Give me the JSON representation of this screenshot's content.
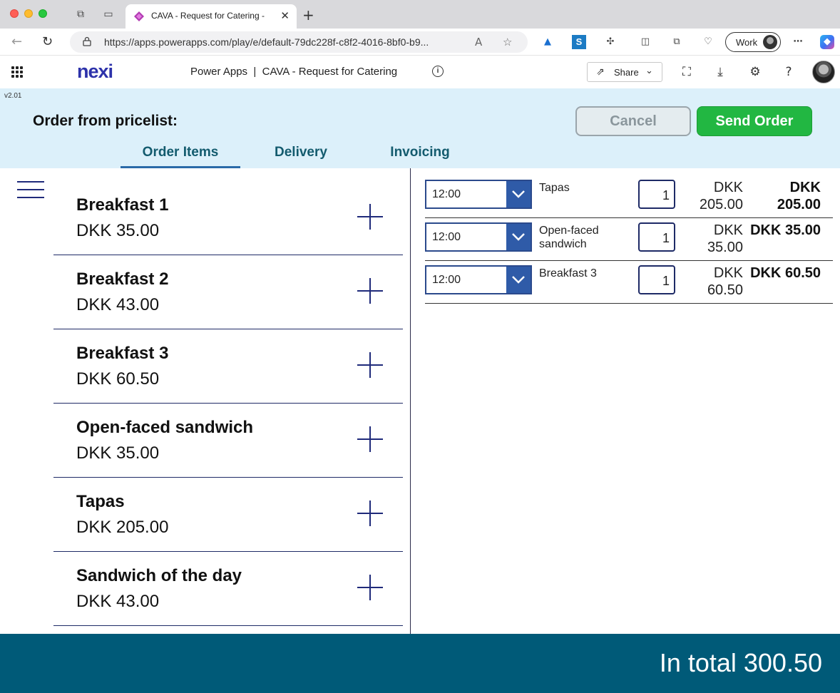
{
  "browser": {
    "tab_title": "CAVA - Request for Catering - ",
    "url": "https://apps.powerapps.com/play/e/default-79dc228f-c8f2-4016-8bf0-b9...",
    "profile_label": "Work"
  },
  "header": {
    "logo": "nexi",
    "app_title": "Power Apps  |  CAVA - Request for Catering",
    "share_label": "Share"
  },
  "app": {
    "version": "v2.01",
    "order_title": "Order from pricelist:",
    "cancel_label": "Cancel",
    "send_label": "Send Order",
    "tabs": [
      {
        "label": "Order Items",
        "active": true
      },
      {
        "label": "Delivery",
        "active": false
      },
      {
        "label": "Invoicing",
        "active": false
      }
    ],
    "menu_items": [
      {
        "name": "Breakfast 1",
        "price": "DKK 35.00"
      },
      {
        "name": "Breakfast 2",
        "price": "DKK 43.00"
      },
      {
        "name": "Breakfast 3",
        "price": "DKK 60.50"
      },
      {
        "name": "Open-faced sandwich",
        "price": "DKK 35.00"
      },
      {
        "name": "Tapas",
        "price": "DKK 205.00"
      },
      {
        "name": "Sandwich of the day",
        "price": "DKK 43.00"
      }
    ],
    "order_lines": [
      {
        "time": "12:00",
        "name": "Tapas",
        "qty": "1",
        "unit_price": "DKK 205.00",
        "total": "DKK 205.00"
      },
      {
        "time": "12:00",
        "name": "Open-faced sandwich",
        "qty": "1",
        "unit_price": "DKK 35.00",
        "total": "DKK 35.00"
      },
      {
        "time": "12:00",
        "name": "Breakfast 3",
        "qty": "1",
        "unit_price": "DKK 60.50",
        "total": "DKK 60.50"
      }
    ],
    "total_text": "In total 300.50"
  },
  "colors": {
    "brand": "#2d32aa",
    "band": "#dcf0fa",
    "send_green": "#22b742",
    "footer": "#005a78",
    "dropdown_blue": "#2f5ba8"
  }
}
